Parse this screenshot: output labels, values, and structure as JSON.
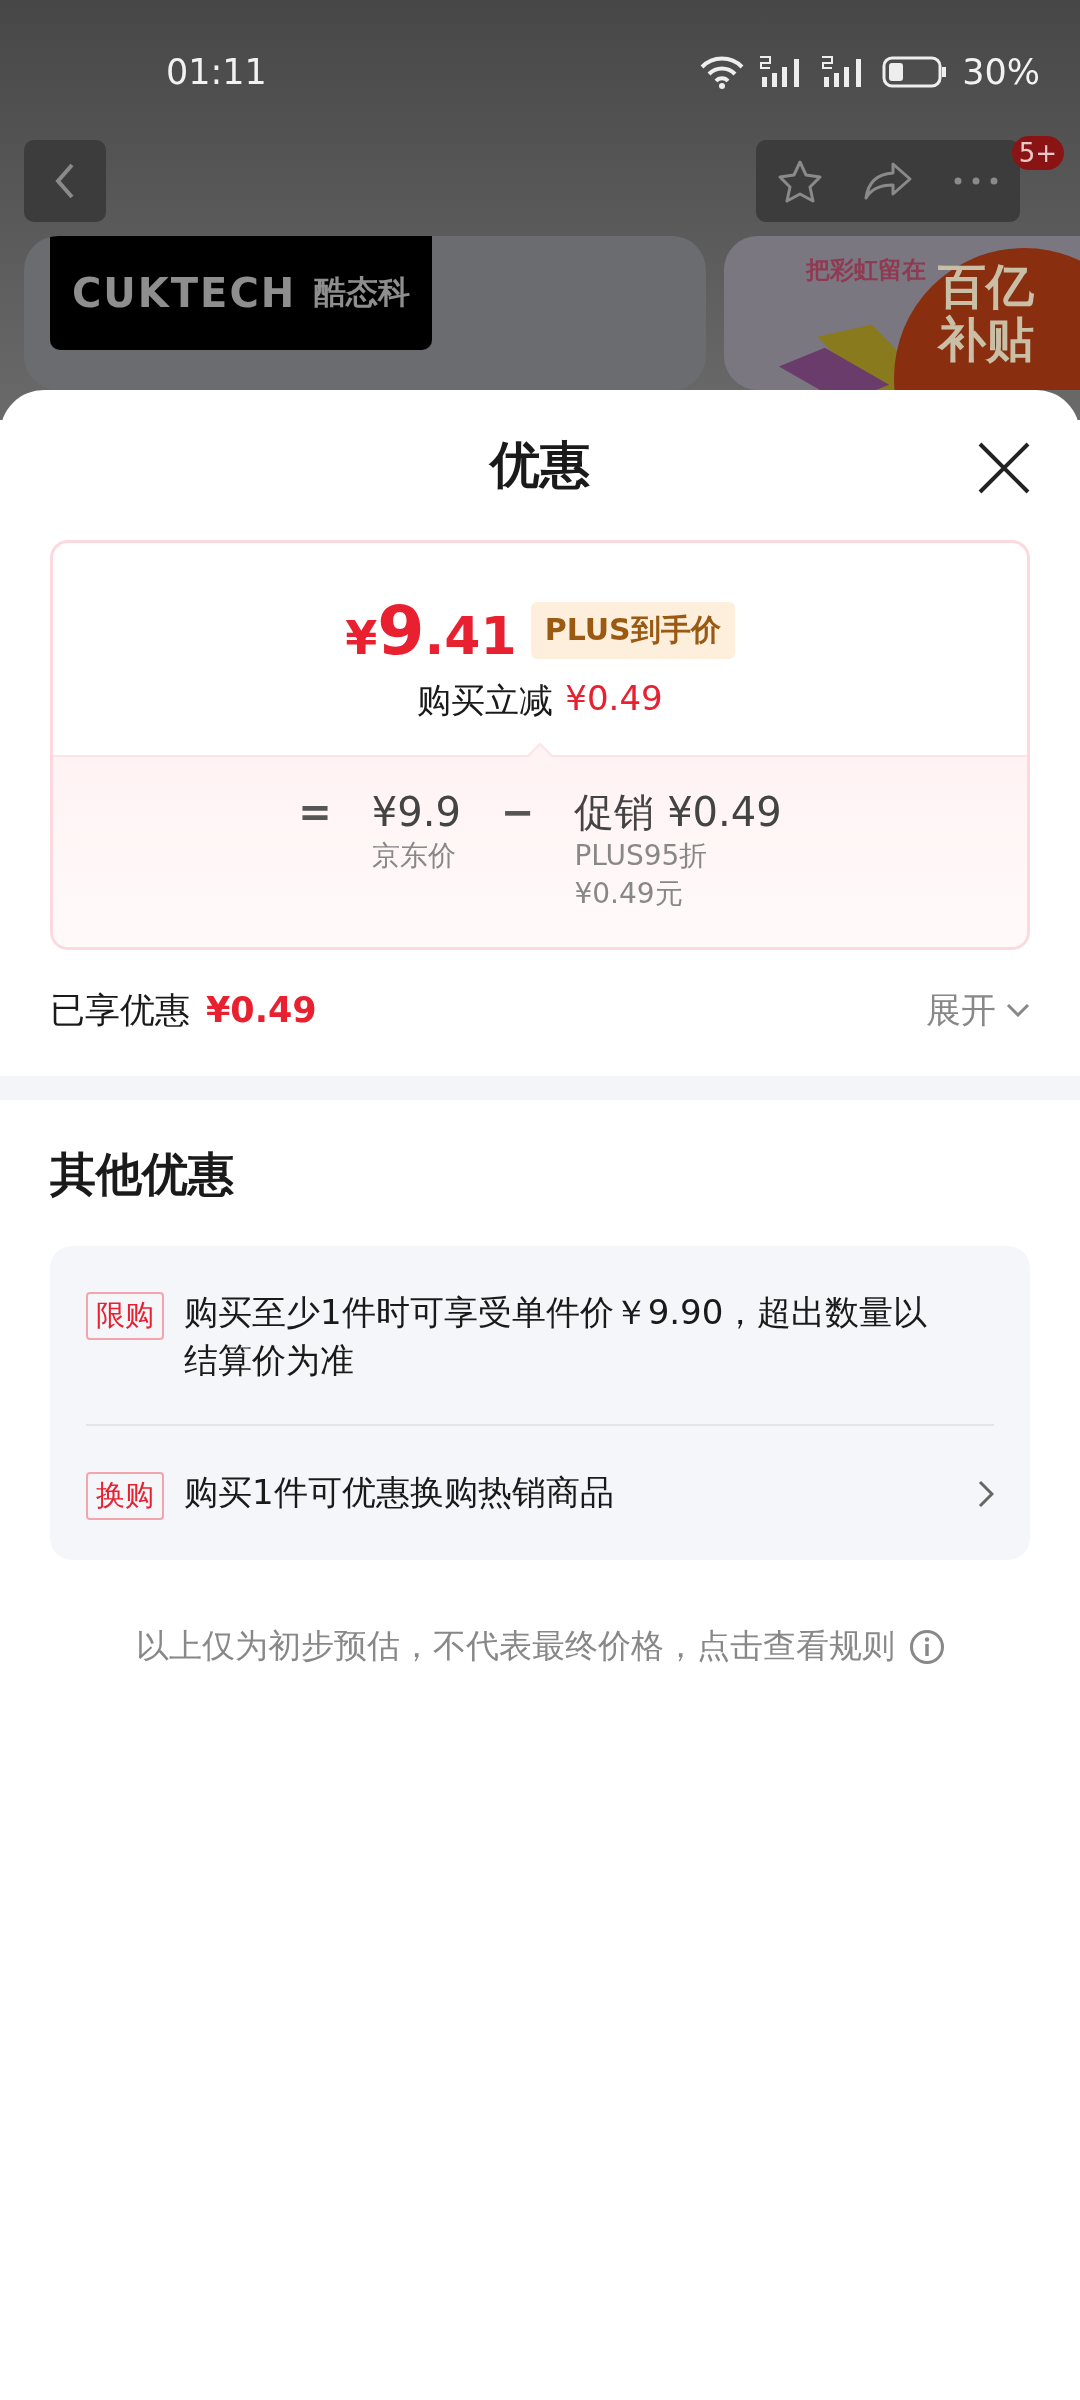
{
  "status_bar": {
    "time": "01:11",
    "battery": "30%"
  },
  "nav": {
    "badge": "5+"
  },
  "banners": [
    {
      "kind": "logo",
      "brand": "CUKTECH",
      "brand_cn": "酷态科"
    },
    {
      "kind": "promo",
      "slogan": "把彩虹留在",
      "badge_lines": [
        "百亿",
        "补贴"
      ]
    }
  ],
  "sheet": {
    "title": "优惠",
    "price_card": {
      "currency": "¥",
      "integer": "9",
      "decimal": ".41",
      "tag": "PLUS到手价",
      "saving_label": "购买立减",
      "saving": "¥0.49",
      "breakdown": [
        {
          "kind": "operator",
          "symbol": "="
        },
        {
          "kind": "term",
          "amount": "¥9.9",
          "notes": [
            "京东价"
          ]
        },
        {
          "kind": "operator",
          "symbol": "−"
        },
        {
          "kind": "term",
          "label": "促销",
          "amount": "¥0.49",
          "notes": [
            "PLUS95折",
            "¥0.49元"
          ]
        }
      ]
    },
    "enjoyed": {
      "label": "已享优惠",
      "amount": "¥0.49",
      "expand": "展开"
    },
    "other": {
      "title": "其他优惠",
      "offers": [
        {
          "tag": "限购",
          "text": "购买至少1件时可享受单件价￥9.90，超出数量以结算价为准",
          "arrow": false
        },
        {
          "tag": "换购",
          "text": "购买1件可优惠换购热销商品",
          "arrow": true
        }
      ]
    },
    "note": "以上仅为初步预估，不代表最终价格，点击查看规则"
  }
}
